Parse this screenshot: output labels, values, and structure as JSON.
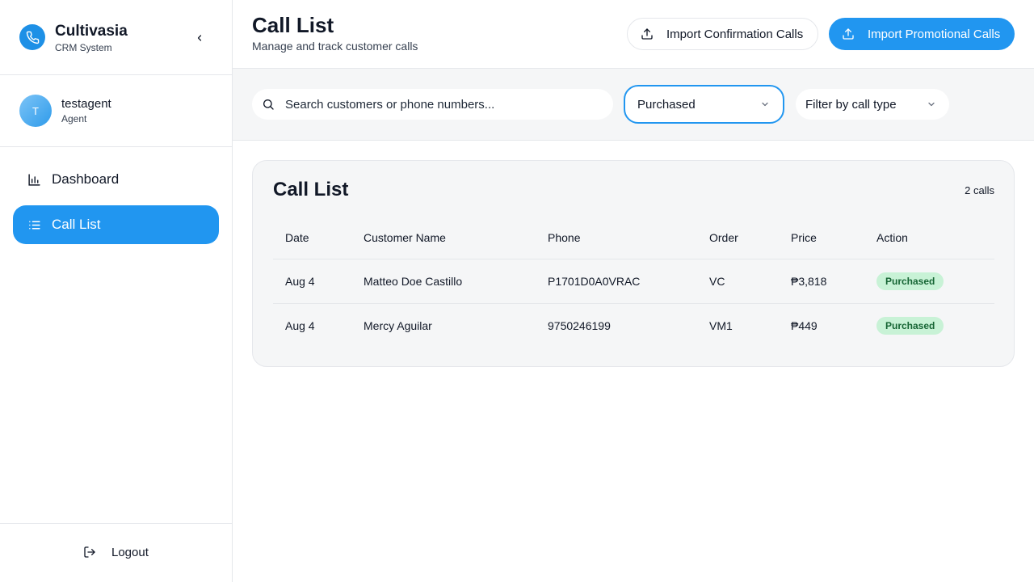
{
  "app": {
    "name": "Cultivasia",
    "subtitle": "CRM System"
  },
  "user": {
    "initial": "T",
    "name": "testagent",
    "role": "Agent"
  },
  "nav": {
    "items": [
      {
        "label": "Dashboard",
        "icon": "bar-chart-icon",
        "active": false
      },
      {
        "label": "Call List",
        "icon": "list-icon",
        "active": true
      }
    ],
    "logout_label": "Logout"
  },
  "header": {
    "title": "Call List",
    "subtitle": "Manage and track customer calls",
    "import_confirmation_label": "Import Confirmation Calls",
    "import_promotional_label": "Import Promotional Calls"
  },
  "filters": {
    "search_placeholder": "Search customers or phone numbers...",
    "status_value": "Purchased",
    "call_type_placeholder": "Filter by call type"
  },
  "table": {
    "title": "Call List",
    "count_label": "2 calls",
    "columns": [
      "Date",
      "Customer Name",
      "Phone",
      "Order",
      "Price",
      "Action"
    ],
    "rows": [
      {
        "date": "Aug 4",
        "customer": "Matteo Doe Castillo",
        "phone": "P1701D0A0VRAC",
        "order": "VC",
        "price": "₱3,818",
        "action": "Purchased"
      },
      {
        "date": "Aug 4",
        "customer": "Mercy Aguilar",
        "phone": "9750246199",
        "order": "VM1",
        "price": "₱449",
        "action": "Purchased"
      }
    ]
  },
  "colors": {
    "accent": "#2196f0",
    "badge_bg": "#c8f2d6",
    "badge_text": "#166534"
  }
}
